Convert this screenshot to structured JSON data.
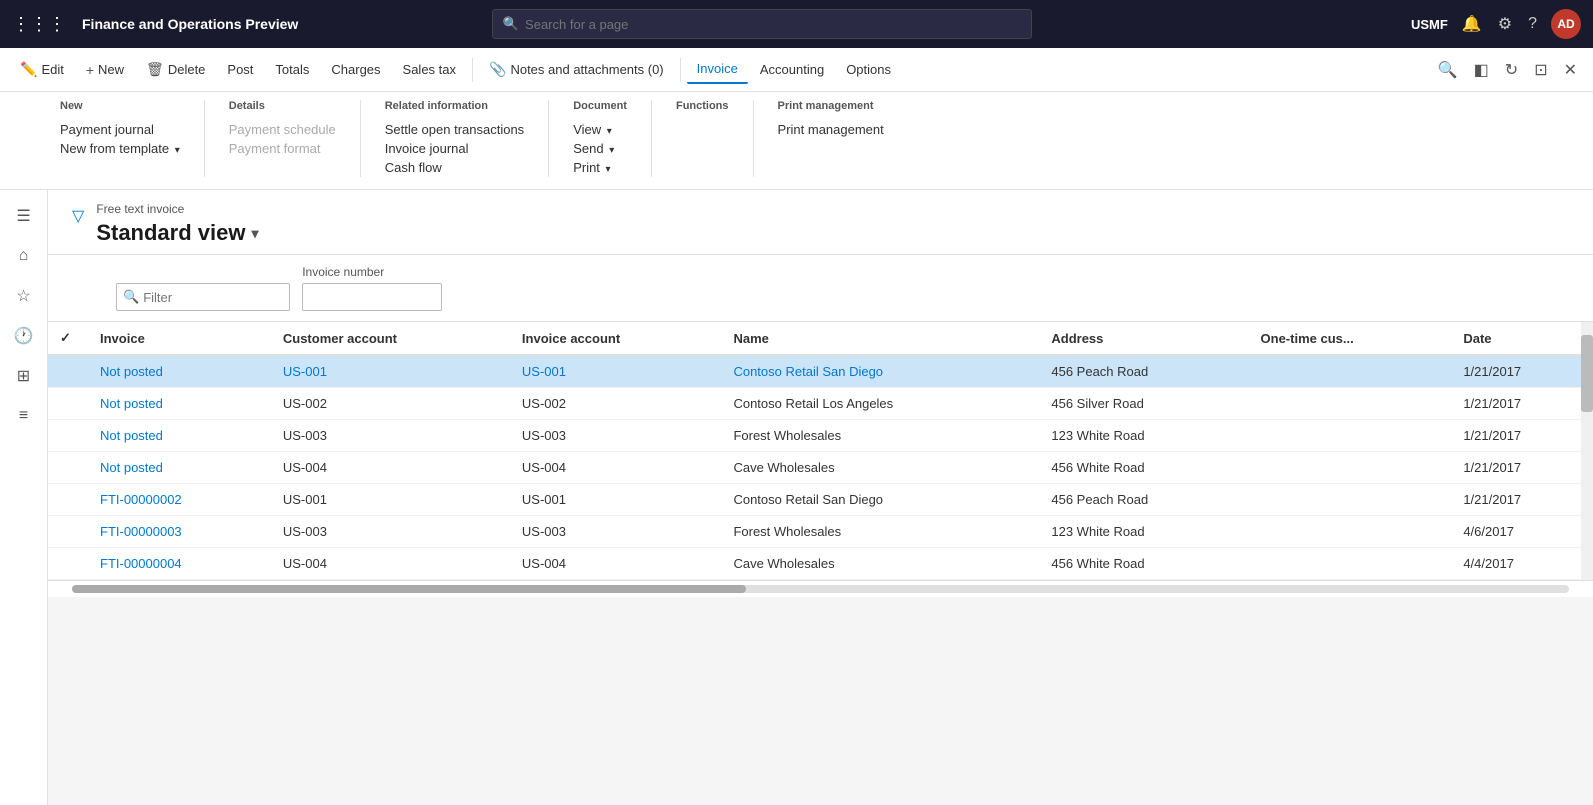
{
  "topNav": {
    "appTitle": "Finance and Operations Preview",
    "searchPlaceholder": "Search for a page",
    "orgLabel": "USMF",
    "avatar": "AD"
  },
  "commandBar": {
    "buttons": [
      {
        "id": "edit",
        "label": "Edit",
        "icon": "✏️"
      },
      {
        "id": "new",
        "label": "New",
        "icon": "+"
      },
      {
        "id": "delete",
        "label": "Delete",
        "icon": "🗑"
      },
      {
        "id": "post",
        "label": "Post",
        "icon": ""
      },
      {
        "id": "totals",
        "label": "Totals",
        "icon": ""
      },
      {
        "id": "charges",
        "label": "Charges",
        "icon": ""
      },
      {
        "id": "salesTax",
        "label": "Sales tax",
        "icon": ""
      },
      {
        "id": "notesAttachments",
        "label": "Notes and attachments (0)",
        "icon": "📎"
      },
      {
        "id": "invoice",
        "label": "Invoice",
        "icon": ""
      },
      {
        "id": "accounting",
        "label": "Accounting",
        "icon": ""
      },
      {
        "id": "options",
        "label": "Options",
        "icon": ""
      }
    ],
    "activeTab": "Invoice"
  },
  "dropdownMenu": {
    "sections": [
      {
        "header": "New",
        "items": [
          {
            "label": "Payment journal",
            "disabled": false
          },
          {
            "label": "New from template",
            "disabled": false,
            "hasArrow": true
          }
        ]
      },
      {
        "header": "Details",
        "items": [
          {
            "label": "Payment schedule",
            "disabled": true
          },
          {
            "label": "Payment format",
            "disabled": true
          }
        ]
      },
      {
        "header": "Related information",
        "items": [
          {
            "label": "Settle open transactions",
            "disabled": false
          },
          {
            "label": "Invoice journal",
            "disabled": false
          },
          {
            "label": "Cash flow",
            "disabled": false
          }
        ]
      },
      {
        "header": "Document",
        "items": [
          {
            "label": "View",
            "disabled": false,
            "hasArrow": true
          },
          {
            "label": "Send",
            "disabled": false,
            "hasArrow": true
          },
          {
            "label": "Print",
            "disabled": false,
            "hasArrow": true
          }
        ]
      },
      {
        "header": "Functions",
        "items": []
      },
      {
        "header": "Print management",
        "items": [
          {
            "label": "Print management",
            "disabled": false
          }
        ]
      }
    ]
  },
  "page": {
    "breadcrumb": "Free text invoice",
    "title": "Standard view",
    "filterPlaceholder": "Filter",
    "invoiceNumberLabel": "Invoice number",
    "invoiceNumberValue": ""
  },
  "table": {
    "columns": [
      {
        "id": "check",
        "label": "✓"
      },
      {
        "id": "invoice",
        "label": "Invoice"
      },
      {
        "id": "customerAccount",
        "label": "Customer account"
      },
      {
        "id": "invoiceAccount",
        "label": "Invoice account"
      },
      {
        "id": "name",
        "label": "Name"
      },
      {
        "id": "address",
        "label": "Address"
      },
      {
        "id": "oneTimeCus",
        "label": "One-time cus..."
      },
      {
        "id": "date",
        "label": "Date"
      }
    ],
    "rows": [
      {
        "selected": true,
        "invoice": "Not posted",
        "invoiceLink": true,
        "customerAccount": "US-001",
        "customerLink": true,
        "invoiceAccount": "US-001",
        "invoiceAccLink": true,
        "name": "Contoso Retail San Diego",
        "nameLink": true,
        "address": "456 Peach Road",
        "oneTimeCus": "",
        "date": "1/21/2017"
      },
      {
        "selected": false,
        "invoice": "Not posted",
        "invoiceLink": true,
        "customerAccount": "US-002",
        "customerLink": false,
        "invoiceAccount": "US-002",
        "invoiceAccLink": false,
        "name": "Contoso Retail Los Angeles",
        "nameLink": false,
        "address": "456 Silver Road",
        "oneTimeCus": "",
        "date": "1/21/2017"
      },
      {
        "selected": false,
        "invoice": "Not posted",
        "invoiceLink": true,
        "customerAccount": "US-003",
        "customerLink": false,
        "invoiceAccount": "US-003",
        "invoiceAccLink": false,
        "name": "Forest Wholesales",
        "nameLink": false,
        "address": "123 White Road",
        "oneTimeCus": "",
        "date": "1/21/2017"
      },
      {
        "selected": false,
        "invoice": "Not posted",
        "invoiceLink": true,
        "customerAccount": "US-004",
        "customerLink": false,
        "invoiceAccount": "US-004",
        "invoiceAccLink": false,
        "name": "Cave Wholesales",
        "nameLink": false,
        "address": "456 White Road",
        "oneTimeCus": "",
        "date": "1/21/2017"
      },
      {
        "selected": false,
        "invoice": "FTI-00000002",
        "invoiceLink": true,
        "customerAccount": "US-001",
        "customerLink": false,
        "invoiceAccount": "US-001",
        "invoiceAccLink": false,
        "name": "Contoso Retail San Diego",
        "nameLink": false,
        "address": "456 Peach Road",
        "oneTimeCus": "",
        "date": "1/21/2017"
      },
      {
        "selected": false,
        "invoice": "FTI-00000003",
        "invoiceLink": true,
        "customerAccount": "US-003",
        "customerLink": false,
        "invoiceAccount": "US-003",
        "invoiceAccLink": false,
        "name": "Forest Wholesales",
        "nameLink": false,
        "address": "123 White Road",
        "oneTimeCus": "",
        "date": "4/6/2017"
      },
      {
        "selected": false,
        "invoice": "FTI-00000004",
        "invoiceLink": true,
        "customerAccount": "US-004",
        "customerLink": false,
        "invoiceAccount": "US-004",
        "invoiceAccLink": false,
        "name": "Cave Wholesales",
        "nameLink": false,
        "address": "456 White Road",
        "oneTimeCus": "",
        "date": "4/4/2017"
      }
    ]
  },
  "sidebar": {
    "icons": [
      {
        "id": "hamburger",
        "symbol": "☰",
        "label": "hamburger-menu"
      },
      {
        "id": "home",
        "symbol": "⌂",
        "label": "home"
      },
      {
        "id": "star",
        "symbol": "★",
        "label": "favorites"
      },
      {
        "id": "recent",
        "symbol": "🕐",
        "label": "recent"
      },
      {
        "id": "workspace",
        "symbol": "⊞",
        "label": "workspace"
      },
      {
        "id": "list",
        "symbol": "☰",
        "label": "list-view"
      }
    ]
  }
}
